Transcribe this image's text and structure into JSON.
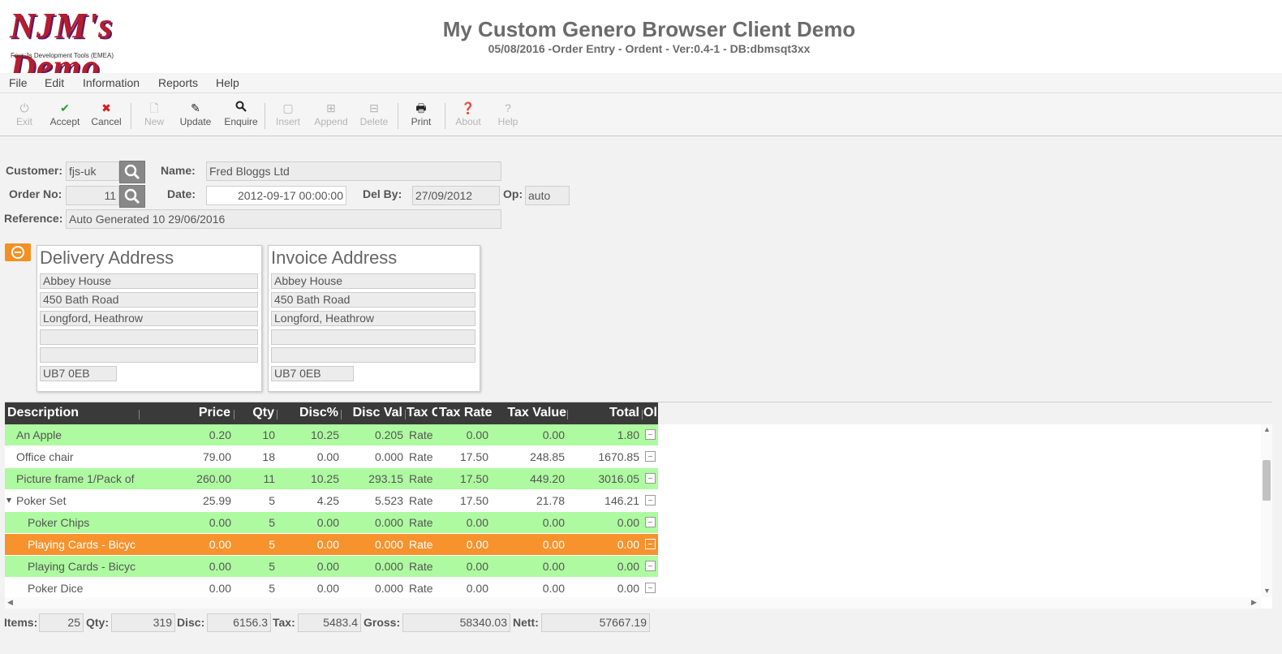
{
  "header": {
    "logo_main": "NJM's Demo",
    "logo_sub": "Four Js Development Tools (EMEA)",
    "title": "My Custom Genero Browser Client Demo",
    "subtitle": "05/08/2016 -Order Entry - Ordent - Ver:0.4-1 - DB:dbmsqt3xx"
  },
  "menu": [
    "File",
    "Edit",
    "Information",
    "Reports",
    "Help"
  ],
  "toolbar": {
    "exit": "Exit",
    "accept": "Accept",
    "cancel": "Cancel",
    "new": "New",
    "update": "Update",
    "enquire": "Enquire",
    "insert": "Insert",
    "append": "Append",
    "delete": "Delete",
    "print": "Print",
    "about": "About",
    "help": "Help"
  },
  "form": {
    "customer_label": "Customer:",
    "customer": "fjs-uk",
    "name_label": "Name:",
    "name": "Fred Bloggs Ltd",
    "order_label": "Order No:",
    "order": "11",
    "date_label": "Date:",
    "date": "2012-09-17 00:00:00",
    "delby_label": "Del By:",
    "delby": "27/09/2012",
    "op_label": "Op:",
    "op": "auto",
    "ref_label": "Reference:",
    "ref": "Auto Generated 10 29/06/2016"
  },
  "delivery": {
    "title": "Delivery Address",
    "lines": [
      "Abbey House",
      "450 Bath Road",
      "Longford, Heathrow",
      "",
      ""
    ],
    "postcode": "UB7 0EB"
  },
  "invoice": {
    "title": "Invoice Address",
    "lines": [
      "Abbey House",
      "450 Bath Road",
      "Longford, Heathrow",
      "",
      ""
    ],
    "postcode": "UB7 0EB"
  },
  "grid": {
    "columns": [
      "Description",
      "Price",
      "Qty",
      "Disc%",
      "Disc Val",
      "Tax C",
      "Tax Rate",
      "Tax Value",
      "Total",
      "Ol"
    ],
    "rows": [
      {
        "desc": "An Apple",
        "price": "0.20",
        "qty": "10",
        "discp": "10.25",
        "discv": "0.205",
        "taxc": "Rate",
        "taxr": "0.00",
        "taxv": "0.00",
        "total": "1.80",
        "style": "green",
        "indent": 1,
        "tree": ""
      },
      {
        "desc": "Office chair",
        "price": "79.00",
        "qty": "18",
        "discp": "0.00",
        "discv": "0.000",
        "taxc": "Rate",
        "taxr": "17.50",
        "taxv": "248.85",
        "total": "1670.85",
        "style": "white",
        "indent": 1,
        "tree": ""
      },
      {
        "desc": "Picture frame 1/Pack of",
        "price": "260.00",
        "qty": "11",
        "discp": "10.25",
        "discv": "293.15",
        "taxc": "Rate",
        "taxr": "17.50",
        "taxv": "449.20",
        "total": "3016.05",
        "style": "green",
        "indent": 1,
        "tree": ""
      },
      {
        "desc": "Poker Set",
        "price": "25.99",
        "qty": "5",
        "discp": "4.25",
        "discv": "5.523",
        "taxc": "Rate",
        "taxr": "17.50",
        "taxv": "21.78",
        "total": "146.21",
        "style": "white",
        "indent": 1,
        "tree": "▾"
      },
      {
        "desc": "Poker Chips",
        "price": "0.00",
        "qty": "5",
        "discp": "0.00",
        "discv": "0.000",
        "taxc": "Rate",
        "taxr": "0.00",
        "taxv": "0.00",
        "total": "0.00",
        "style": "green",
        "indent": 2,
        "tree": ""
      },
      {
        "desc": "Playing Cards - Bicyc",
        "price": "0.00",
        "qty": "5",
        "discp": "0.00",
        "discv": "0.000",
        "taxc": "Rate",
        "taxr": "0.00",
        "taxv": "0.00",
        "total": "0.00",
        "style": "orange",
        "indent": 2,
        "tree": ""
      },
      {
        "desc": "Playing Cards - Bicyc",
        "price": "0.00",
        "qty": "5",
        "discp": "0.00",
        "discv": "0.000",
        "taxc": "Rate",
        "taxr": "0.00",
        "taxv": "0.00",
        "total": "0.00",
        "style": "green",
        "indent": 2,
        "tree": ""
      },
      {
        "desc": "Poker Dice",
        "price": "0.00",
        "qty": "5",
        "discp": "0.00",
        "discv": "0.000",
        "taxc": "Rate",
        "taxr": "0.00",
        "taxv": "0.00",
        "total": "0.00",
        "style": "white",
        "indent": 2,
        "tree": ""
      }
    ]
  },
  "totals": {
    "items_label": "Items:",
    "items": "25",
    "qty_label": "Qty:",
    "qty": "319",
    "disc_label": "Disc:",
    "disc": "6156.3",
    "tax_label": "Tax:",
    "tax": "5483.4",
    "gross_label": "Gross:",
    "gross": "58340.03",
    "nett_label": "Nett:",
    "nett": "57667.19"
  },
  "colors": {
    "accent_orange": "#f7922d",
    "row_green": "#aefaa0",
    "header_dark": "#3a3a3a",
    "accept_green": "#2aa02a",
    "cancel_red": "#d61a1a"
  }
}
